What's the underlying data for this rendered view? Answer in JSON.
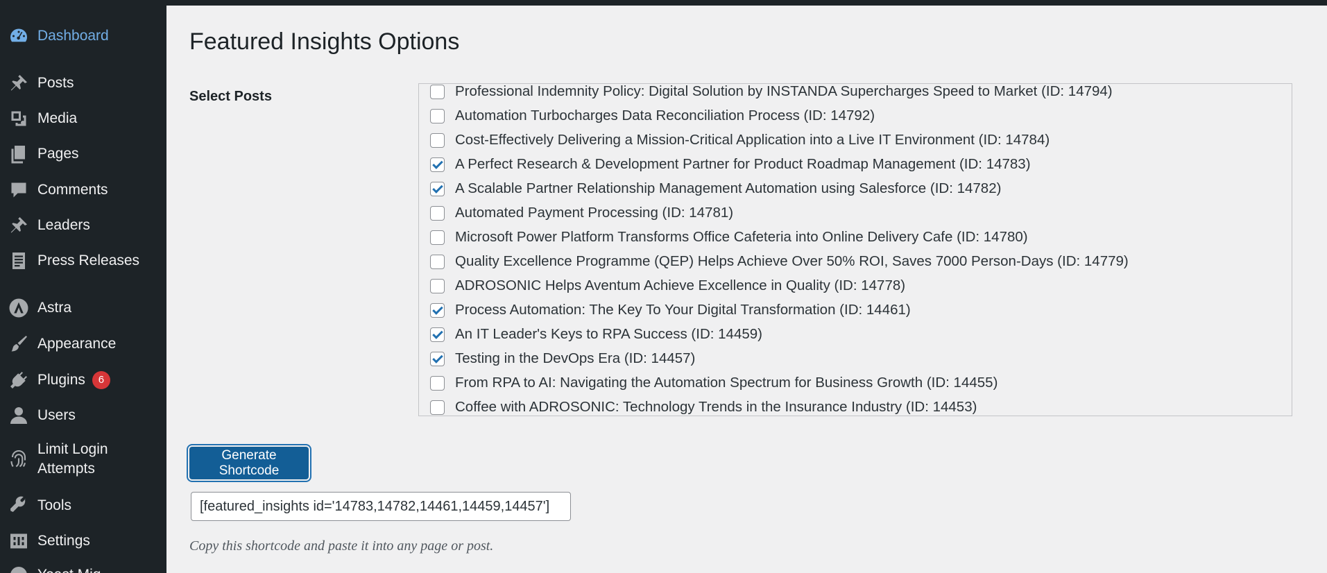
{
  "sidebar": {
    "items": [
      {
        "label": "Dashboard",
        "icon": "dashboard-icon",
        "current": true
      },
      {
        "label": "Posts",
        "icon": "pushpin-icon"
      },
      {
        "label": "Media",
        "icon": "media-icon"
      },
      {
        "label": "Pages",
        "icon": "pages-icon"
      },
      {
        "label": "Comments",
        "icon": "comments-icon"
      },
      {
        "label": "Leaders",
        "icon": "pushpin-icon"
      },
      {
        "label": "Press Releases",
        "icon": "document-icon"
      },
      {
        "label": "Astra",
        "icon": "astra-icon"
      },
      {
        "label": "Appearance",
        "icon": "paintbrush-icon"
      },
      {
        "label": "Plugins",
        "icon": "plugins-icon",
        "badge": "6"
      },
      {
        "label": "Users",
        "icon": "users-icon"
      },
      {
        "label": "Limit Login Attempts",
        "label_line1": "Limit Login",
        "label_line2": "Attempts",
        "icon": "fingerprint-icon"
      },
      {
        "label": "Tools",
        "icon": "wrench-icon"
      },
      {
        "label": "Settings",
        "icon": "settings-icon"
      },
      {
        "label": "Yoast/MonsterInsights (partially visible)",
        "icon": "monsterinsights-icon"
      }
    ]
  },
  "main": {
    "title": "Featured Insights Options",
    "select_label": "Select Posts",
    "posts": [
      {
        "text": "Professional Indemnity Policy: Digital Solution by INSTANDA Supercharges Speed to Market (ID: 14794)",
        "checked": false
      },
      {
        "text": "Automation Turbocharges Data Reconciliation Process (ID: 14792)",
        "checked": false
      },
      {
        "text": "Cost-Effectively Delivering a Mission-Critical Application into a Live IT Environment (ID: 14784)",
        "checked": false
      },
      {
        "text": "A Perfect Research & Development Partner for Product Roadmap Management (ID: 14783)",
        "checked": true
      },
      {
        "text": "A Scalable Partner Relationship Management Automation using Salesforce (ID: 14782)",
        "checked": true
      },
      {
        "text": "Automated Payment Processing (ID: 14781)",
        "checked": false
      },
      {
        "text": "Microsoft Power Platform Transforms Office Cafeteria into Online Delivery Cafe (ID: 14780)",
        "checked": false
      },
      {
        "text": "Quality Excellence Programme (QEP) Helps Achieve Over 50% ROI, Saves 7000 Person-Days (ID: 14779)",
        "checked": false
      },
      {
        "text": "ADROSONIC Helps Aventum Achieve Excellence in Quality (ID: 14778)",
        "checked": false
      },
      {
        "text": "Process Automation: The Key To Your Digital Transformation (ID: 14461)",
        "checked": true
      },
      {
        "text": "An IT Leader's Keys to RPA Success (ID: 14459)",
        "checked": true
      },
      {
        "text": "Testing in the DevOps Era (ID: 14457)",
        "checked": true
      },
      {
        "text": "From RPA to AI: Navigating the Automation Spectrum for Business Growth (ID: 14455)",
        "checked": false
      },
      {
        "text": "Coffee with ADROSONIC: Technology Trends in the Insurance Industry (ID: 14453)",
        "checked": false
      }
    ],
    "generate_button": "Generate Shortcode",
    "shortcode_value": "[featured_insights id='14783,14782,14461,14459,14457']",
    "hint": "Copy this shortcode and paste it into any page or post."
  },
  "colors": {
    "sidebar_bg": "#1d2327",
    "content_bg": "#f0f0f1",
    "accent": "#2271b1",
    "current_menu": "#72aee6",
    "badge": "#d63638"
  }
}
